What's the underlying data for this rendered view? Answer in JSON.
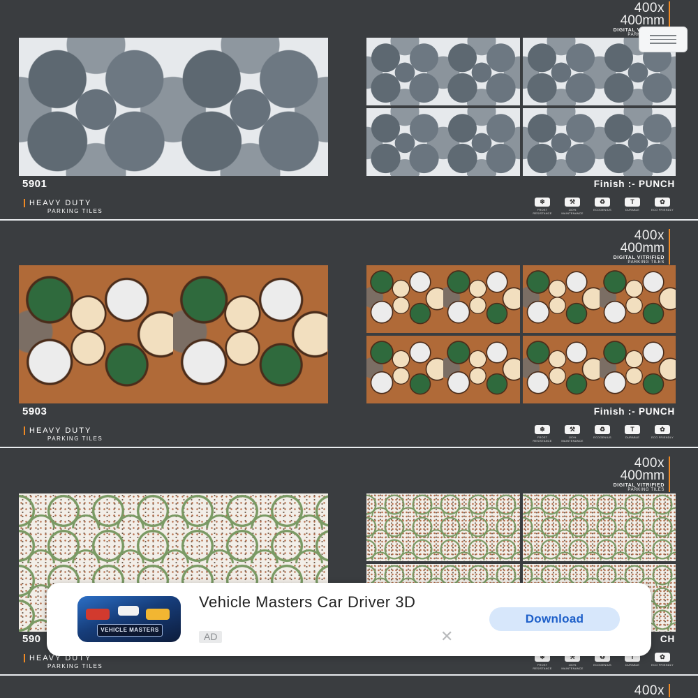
{
  "catalog": {
    "size_line1": "400x",
    "size_line2": "400mm",
    "size_line3": "DIGITAL VITRIFIED",
    "size_line4": "PARKING TILES",
    "brand_line1": "HEAVY DUTY",
    "brand_line2": "PARKING TILES",
    "features": [
      {
        "icon": "snowflake-icon",
        "glyph": "❄",
        "label": "FROST RESISTANCE"
      },
      {
        "icon": "tools-icon",
        "glyph": "⚒",
        "label": "100% MAINTENANCE"
      },
      {
        "icon": "leaf-icon",
        "glyph": "♻",
        "label": "ECOGENIUS"
      },
      {
        "icon": "hammer-icon",
        "glyph": "T",
        "label": "DURABLE"
      },
      {
        "icon": "recycle-icon",
        "glyph": "✿",
        "label": "ECO FRIENDLY"
      }
    ],
    "products": [
      {
        "code": "5901",
        "finish": "Finish :- PUNCH"
      },
      {
        "code": "5903",
        "finish": "Finish :- PUNCH"
      },
      {
        "code": "590",
        "finish": "CH"
      }
    ],
    "next_size_line1": "400x"
  },
  "ad": {
    "title": "Vehicle Masters Car Driver 3D",
    "tag": "AD",
    "close_glyph": "✕",
    "download_label": "Download",
    "icon_text": "VEHICLE MASTERS"
  },
  "colors": {
    "background": "#3a3d40",
    "accent": "#f08a24",
    "download_bg": "#d7e7fb",
    "download_text": "#1d5fc9"
  }
}
